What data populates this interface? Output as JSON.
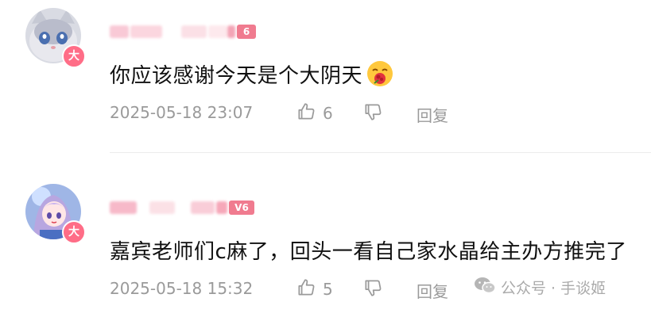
{
  "comments": [
    {
      "badge": "大",
      "level_badge": "6",
      "text": "你应该感谢今天是个大阴天",
      "emoji": "rose-face-emoji",
      "time": "2025-05-18 23:07",
      "likes": "6",
      "reply_label": "回复"
    },
    {
      "badge": "大",
      "level_badge": "V6",
      "text": "嘉宾老师们c麻了，回头一看自己家水晶给主办方推完了",
      "time": "2025-05-18 15:32",
      "likes": "5",
      "reply_label": "回复"
    }
  ],
  "watermark": "公众号 · 手谈姬",
  "colors": {
    "badge": "#ff6d87",
    "meta_text": "#9a9a9a",
    "level": "#f07b8f"
  }
}
